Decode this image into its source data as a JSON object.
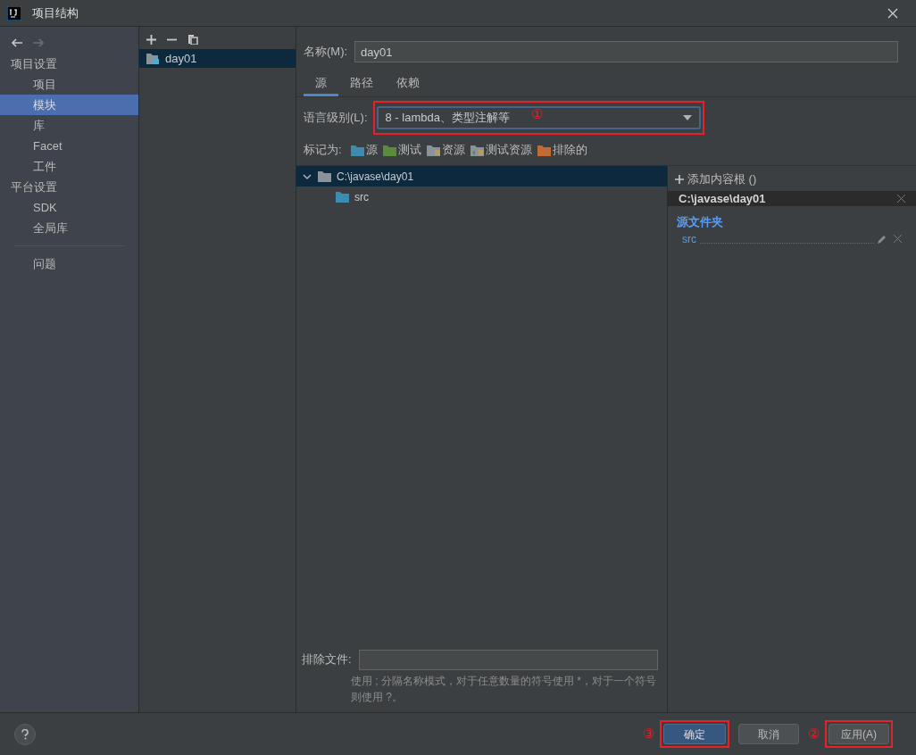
{
  "window": {
    "title": "项目结构"
  },
  "sidebar": {
    "groups": [
      {
        "heading": "项目设置",
        "items": [
          {
            "label": "项目",
            "selected": false
          },
          {
            "label": "模块",
            "selected": true
          },
          {
            "label": "库",
            "selected": false
          },
          {
            "label": "Facet",
            "selected": false
          },
          {
            "label": "工件",
            "selected": false
          }
        ]
      },
      {
        "heading": "平台设置",
        "items": [
          {
            "label": "SDK",
            "selected": false
          },
          {
            "label": "全局库",
            "selected": false
          }
        ]
      }
    ],
    "problems": "问题"
  },
  "modules": [
    {
      "name": "day01",
      "selected": true
    }
  ],
  "name_field": {
    "label": "名称(M):",
    "value": "day01"
  },
  "tabs": [
    {
      "label": "源",
      "selected": true
    },
    {
      "label": "路径",
      "selected": false
    },
    {
      "label": "依赖",
      "selected": false
    }
  ],
  "language_level": {
    "label": "语言级别(L):",
    "value": "8 - lambda、类型注解等",
    "annotation": "①"
  },
  "mark_as": {
    "label": "标记为:",
    "items": [
      {
        "label": "源",
        "color": "#3d8bb0",
        "kind": "plain"
      },
      {
        "label": "测试",
        "color": "#5b8c3e",
        "kind": "plain"
      },
      {
        "label": "资源",
        "color": "#8a9399",
        "kind": "resource"
      },
      {
        "label": "测试资源",
        "color": "#8a9399",
        "kind": "test-resource"
      },
      {
        "label": "排除的",
        "color": "#c26a35",
        "kind": "plain"
      }
    ]
  },
  "tree": [
    {
      "label": "C:\\javase\\day01",
      "expanded": true,
      "selected": true,
      "children": [
        {
          "label": "src"
        }
      ]
    }
  ],
  "content_roots": {
    "add": "添加内容根 ()",
    "root": "C:\\javase\\day01",
    "section": "源文件夹",
    "folders": [
      "src"
    ]
  },
  "exclude": {
    "label": "排除文件:",
    "hint": "使用 ; 分隔名称模式，对于任意数量的符号使用 *，对于一个符号则使用 ?。"
  },
  "buttons": [
    {
      "label": "确定",
      "kind": "primary",
      "annotation": "③"
    },
    {
      "label": "取消",
      "kind": "normal"
    },
    {
      "label": "应用(A)",
      "kind": "normal",
      "annotation": "②"
    }
  ]
}
